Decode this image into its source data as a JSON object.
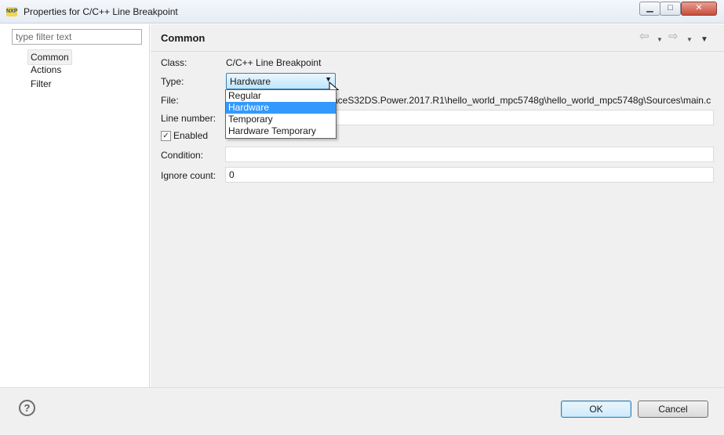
{
  "window": {
    "app_icon_text": "NXP",
    "title": "Properties for C/C++ Line Breakpoint",
    "minimize_glyph": "▁",
    "maximize_glyph": "□",
    "close_glyph": "✕"
  },
  "sidebar": {
    "filter_placeholder": "type filter text",
    "items": [
      {
        "label": "Common",
        "selected": true
      },
      {
        "label": "Actions",
        "selected": false
      },
      {
        "label": "Filter",
        "selected": false
      }
    ]
  },
  "page": {
    "title": "Common",
    "header_icons": [
      "back-arrow-icon",
      "back-menu-icon",
      "forward-arrow-icon",
      "forward-menu-icon",
      "view-menu-icon"
    ]
  },
  "form": {
    "class_label": "Class:",
    "class_value": "C/C++ Line Breakpoint",
    "type_label": "Type:",
    "type_value": "Hardware",
    "file_label": "File:",
    "file_value": "aceS32DS.Power.2017.R1\\hello_world_mpc5748g\\hello_world_mpc5748g\\Sources\\main.c",
    "line_number_label": "Line number:",
    "line_number_value": "",
    "enabled_label": "Enabled",
    "enabled_checked": true,
    "condition_label": "Condition:",
    "condition_value": "",
    "ignore_count_label": "Ignore count:",
    "ignore_count_value": "0"
  },
  "type_dropdown": {
    "options": [
      {
        "label": "Regular",
        "selected": false
      },
      {
        "label": "Hardware",
        "selected": true
      },
      {
        "label": "Temporary",
        "selected": false
      },
      {
        "label": "Hardware Temporary",
        "selected": false
      }
    ]
  },
  "footer": {
    "help_glyph": "?",
    "ok_label": "OK",
    "cancel_label": "Cancel"
  },
  "colors": {
    "selection": "#3399ff",
    "combo_border": "#3c7fb1",
    "panel_background": "#f0f0f0"
  }
}
